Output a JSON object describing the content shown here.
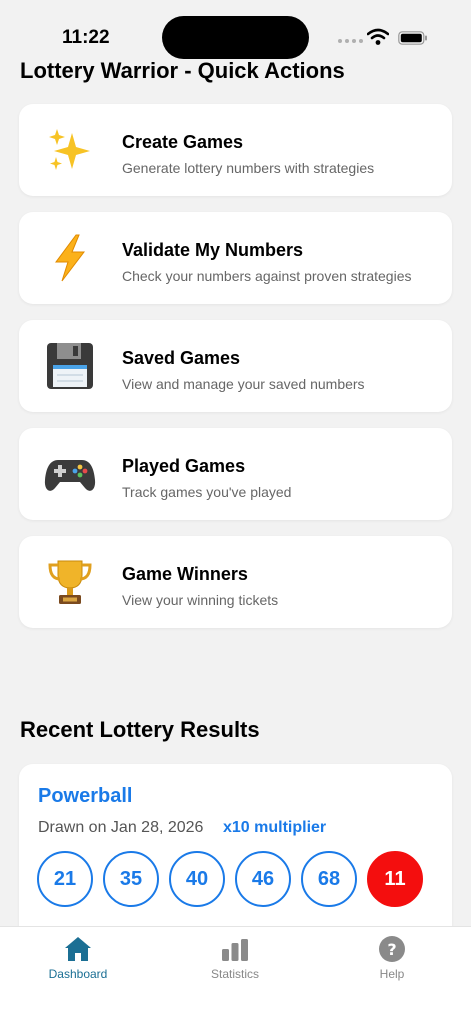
{
  "status_bar": {
    "time": "11:22"
  },
  "quick_actions": {
    "title": "Lottery Warrior - Quick Actions",
    "items": [
      {
        "title": "Create Games",
        "subtitle": "Generate lottery numbers with strategies",
        "icon": "sparkles-icon"
      },
      {
        "title": "Validate My Numbers",
        "subtitle": "Check your numbers against proven strategies",
        "icon": "lightning-icon"
      },
      {
        "title": "Saved Games",
        "subtitle": "View and manage your saved numbers",
        "icon": "floppy-disk-icon"
      },
      {
        "title": "Played Games",
        "subtitle": "Track games you've played",
        "icon": "game-controller-icon"
      },
      {
        "title": "Game Winners",
        "subtitle": "View your winning tickets",
        "icon": "trophy-icon"
      }
    ]
  },
  "recent_results": {
    "title": "Recent Lottery Results",
    "card": {
      "game": "Powerball",
      "drawn": "Drawn on Jan 28, 2026",
      "multiplier": "x10 multiplier",
      "numbers": [
        "21",
        "35",
        "40",
        "46",
        "68"
      ],
      "powerball": "11"
    }
  },
  "tab_bar": {
    "tabs": [
      {
        "label": "Dashboard",
        "icon": "house-icon",
        "active": true
      },
      {
        "label": "Statistics",
        "icon": "bar-chart-icon",
        "active": false
      },
      {
        "label": "Help",
        "icon": "question-icon",
        "active": false
      }
    ]
  },
  "colors": {
    "accent": "#1a7ae8",
    "powerball": "#f40e0e",
    "tab_active": "#1b6f94",
    "background": "#f2f2f2"
  }
}
